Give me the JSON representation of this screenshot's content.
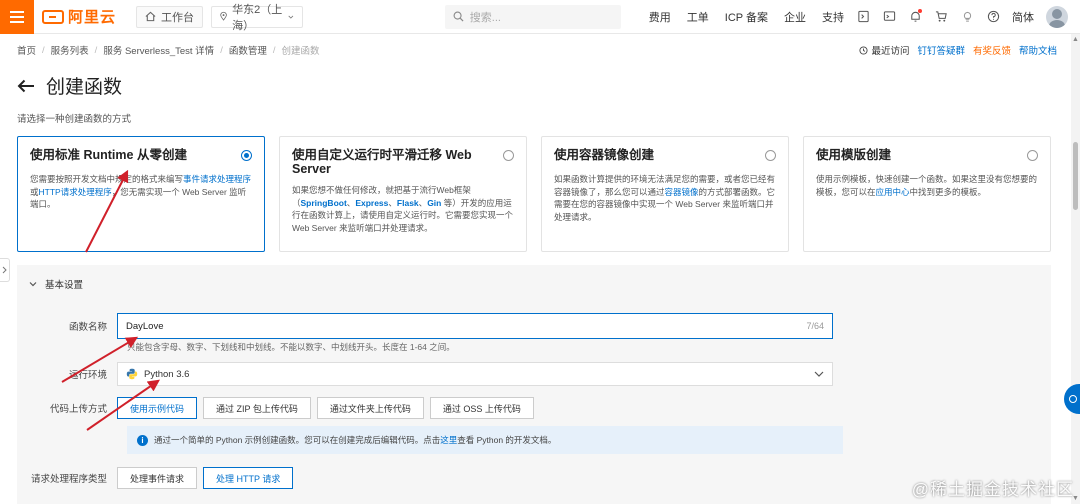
{
  "topbar": {
    "logo_text": "阿里云",
    "workbench": "工作台",
    "region": "华东2（上海）",
    "search_placeholder": "搜索...",
    "links": [
      "费用",
      "工单",
      "ICP 备案",
      "企业",
      "支持"
    ],
    "language": "简体"
  },
  "breadcrumb": {
    "items": [
      "首页",
      "服务列表",
      "服务 Serverless_Test 详情",
      "函数管理"
    ],
    "current": "创建函数",
    "recent": "最近访问",
    "dingtalk": "钉钉答疑群",
    "feedback": "有奖反馈",
    "help": "帮助文档"
  },
  "page": {
    "title": "创建函数",
    "subtitle": "请选择一种创建函数的方式"
  },
  "cards": [
    {
      "title": "使用标准 Runtime 从零创建",
      "selected": true,
      "desc_1": "您需要按照开发文档中规定的格式来编写",
      "link_1": "事件请求处理程序",
      "desc_2": "或",
      "link_2": "HTTP请求处理程序",
      "desc_3": "，您无需实现一个 Web Server 监听端口。"
    },
    {
      "title": "使用自定义运行时平滑迁移 Web Server",
      "selected": false,
      "desc_1": "如果您想不做任何修改，就把基于流行Web框架（",
      "fw_1": "SpringBoot",
      "fw_sep_1": "、",
      "fw_2": "Express",
      "fw_sep_2": "、",
      "fw_3": "Flask",
      "fw_sep_3": "、",
      "fw_4": "Gin",
      "desc_2": " 等）开发的应用运行在函数计算上，请使用自定义运行时。它需要您实现一个 Web Server 来监听端口并处理请求。"
    },
    {
      "title": "使用容器镜像创建",
      "selected": false,
      "desc_1": "如果函数计算提供的环境无法满足您的需要，或者您已经有容器镜像了，那么您可以通过",
      "link_1": "容器镜像",
      "desc_2": "的方式部署函数。它需要在您的容器镜像中实现一个 Web Server 来监听端口并处理请求。"
    },
    {
      "title": "使用模版创建",
      "selected": false,
      "desc_1": "使用示例模板，快速创建一个函数。如果这里没有您想要的模板，您可以在",
      "link_1": "应用中心",
      "desc_2": "中找到更多的模板。"
    }
  ],
  "settings": {
    "section_title": "基本设置",
    "name_label": "函数名称",
    "name_value": "DayLove",
    "name_count": "7/64",
    "name_hint": "只能包含字母、数字、下划线和中划线。不能以数字、中划线开头。长度在 1-64 之间。",
    "runtime_label": "运行环境",
    "runtime_value": "Python 3.6",
    "upload_label": "代码上传方式",
    "upload_options": [
      "使用示例代码",
      "通过 ZIP 包上传代码",
      "通过文件夹上传代码",
      "通过 OSS 上传代码"
    ],
    "upload_selected": 0,
    "info_text_1": "通过一个简单的 Python 示例创建函数。您可以在创建完成后编辑代码。点击",
    "info_link": "这里",
    "info_text_2": "查看 Python 的开发文档。",
    "handler_label": "请求处理程序类型",
    "handler_options": [
      "处理事件请求",
      "处理 HTTP 请求"
    ],
    "handler_selected": 1
  },
  "watermark": "@稀土掘金技术社区",
  "colors": {
    "brand": "#ff6a00",
    "accent": "#0070cc",
    "annotation_arrow": "#d0202a"
  }
}
